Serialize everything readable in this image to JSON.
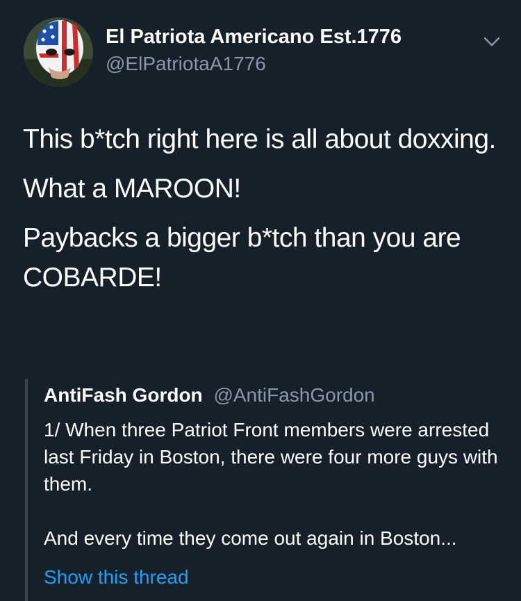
{
  "tweet": {
    "author": {
      "display_name": "El Patriota Americano Est.1776",
      "handle": "@ElPatriotaA1776",
      "avatar_icon": "luchador-mask-flag-avatar"
    },
    "menu_icon": "chevron-down-icon",
    "text": {
      "line1": "This b*tch right here is all about doxxing.",
      "line2": "What a MAROON!",
      "line3": "Paybacks a bigger b*tch than you are COBARDE!"
    },
    "quoted": {
      "display_name": "AntiFash Gordon",
      "handle": "@AntiFashGordon",
      "paragraph1": "1/ When three Patriot Front members were arrested last Friday in Boston, there were four more guys with them.",
      "paragraph2": "And every time they come out again in Boston...",
      "show_thread_label": "Show this thread"
    }
  },
  "colors": {
    "background": "#15202b",
    "text_primary": "#ffffff",
    "text_secondary": "#8899a6",
    "link": "#1da1f2",
    "quote_border": "#38444d"
  }
}
